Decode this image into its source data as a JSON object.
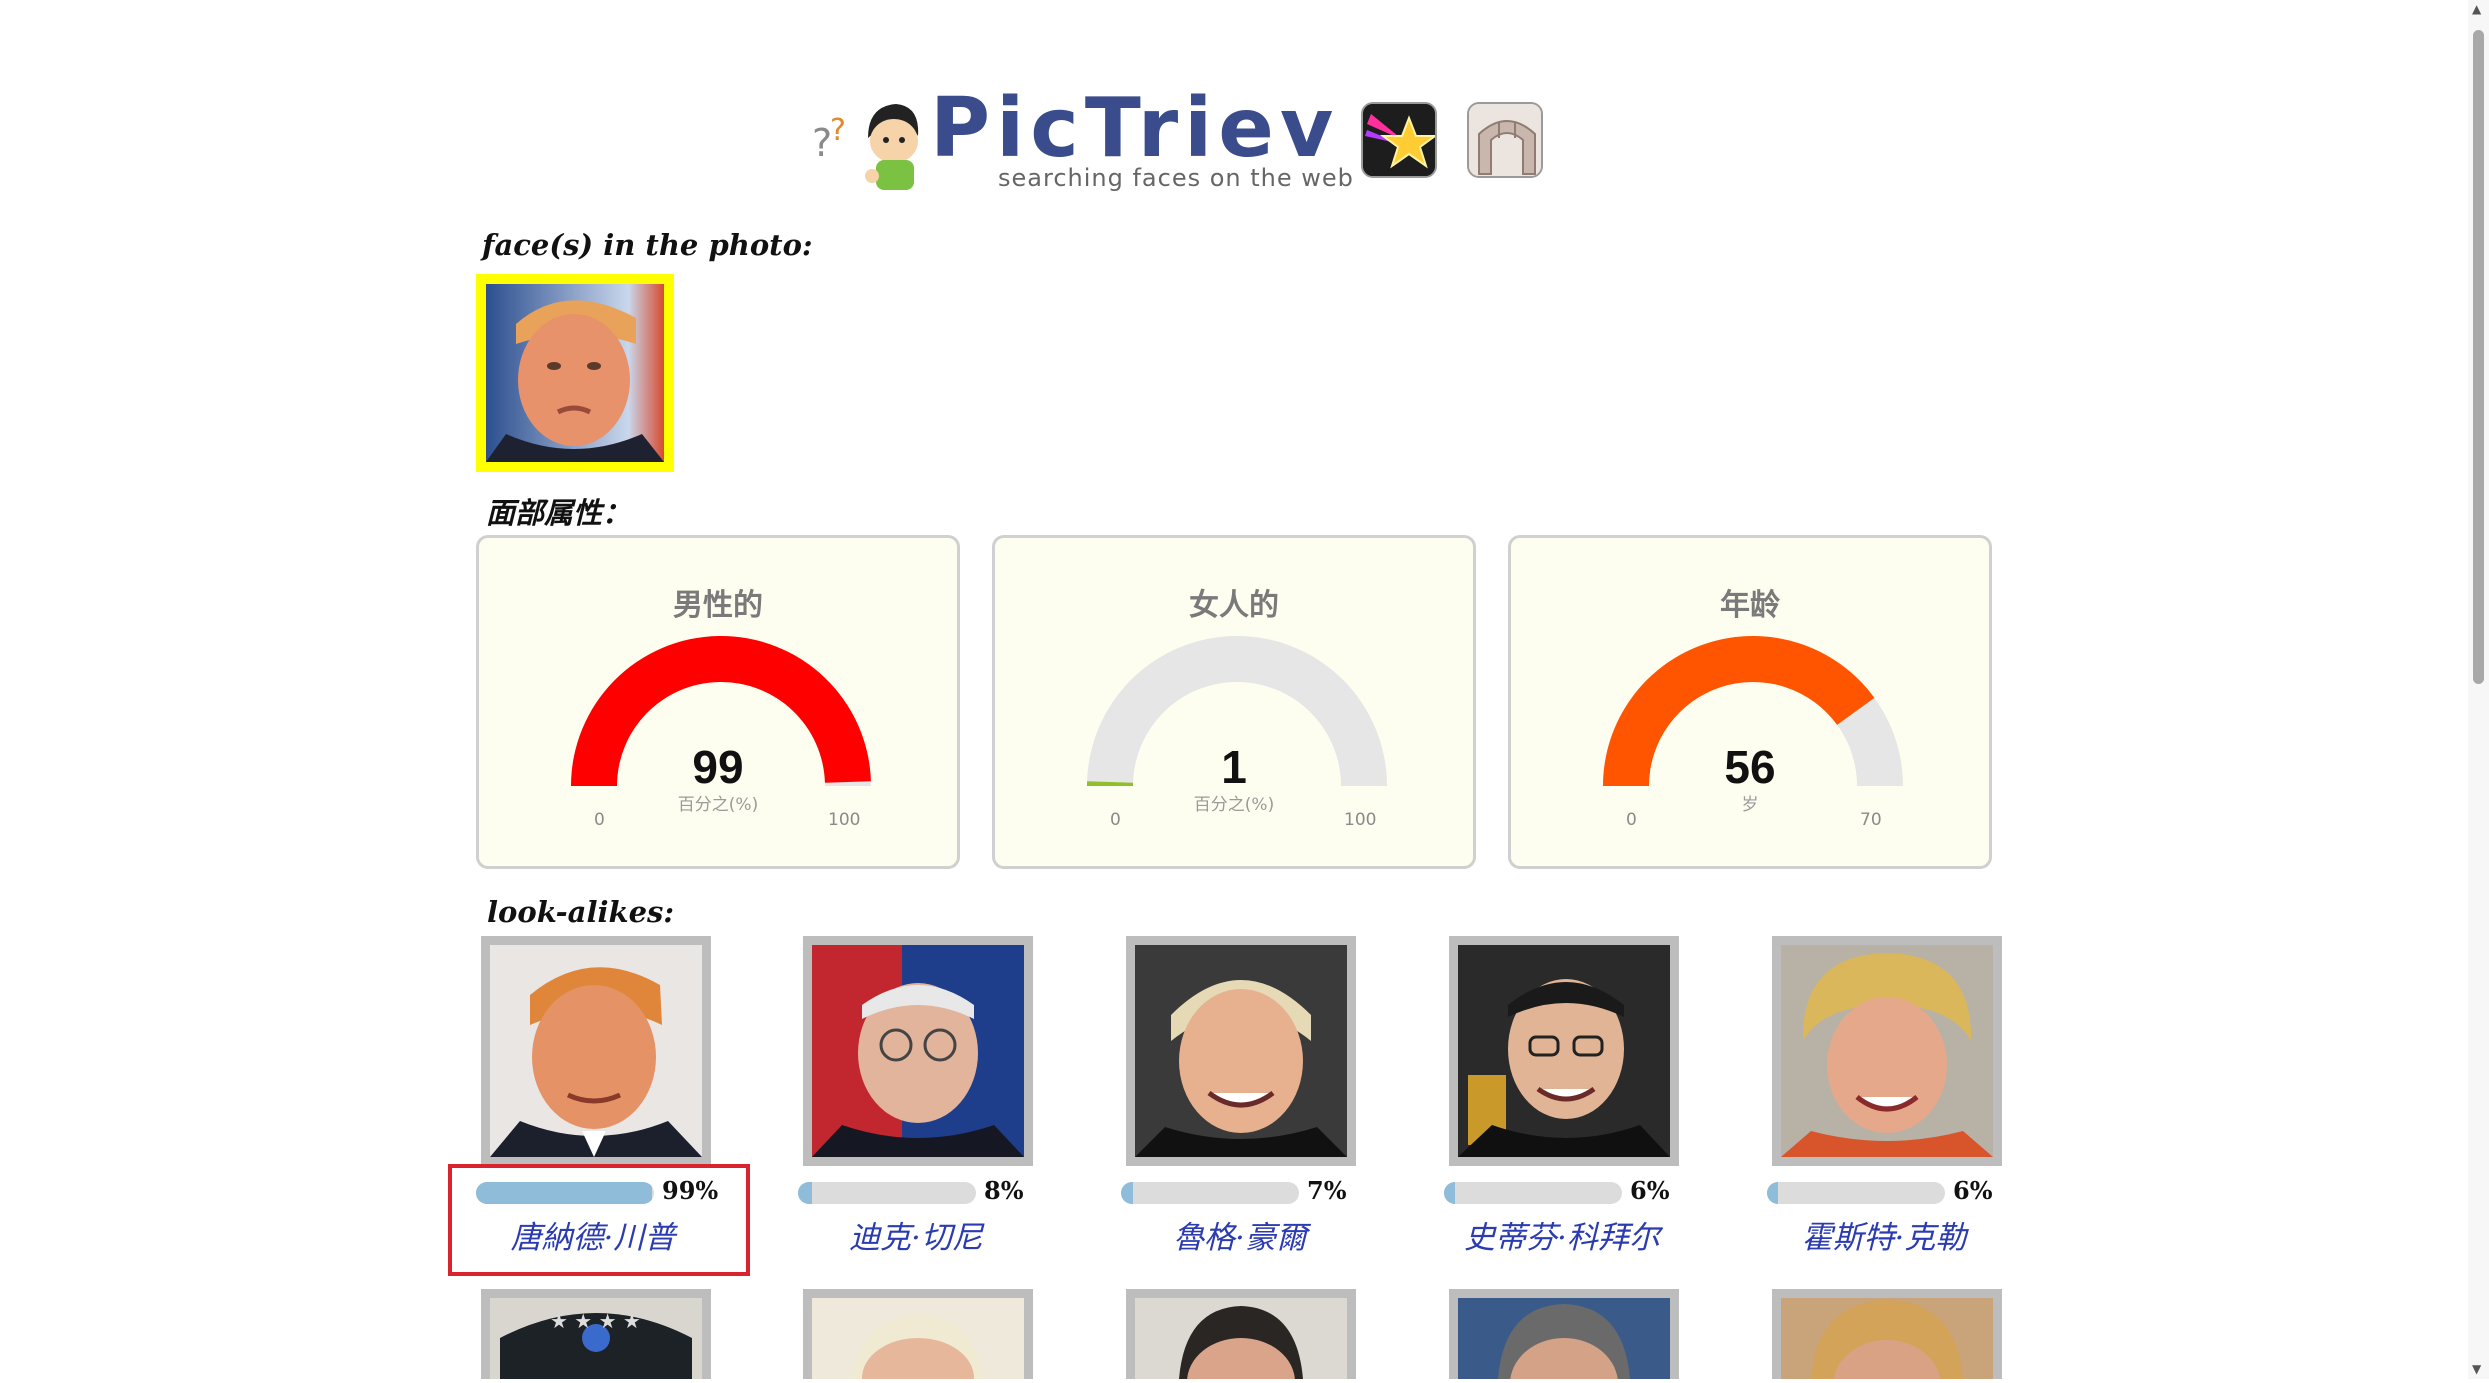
{
  "header": {
    "logo_title": "PicTriev",
    "logo_subtitle": "searching faces on the web",
    "buttons": [
      {
        "name": "celebrity-star",
        "icon": "shooting-star-icon"
      },
      {
        "name": "face-compare",
        "icon": "arch-icon"
      }
    ]
  },
  "faces_section": {
    "label": "face(s) in the photo:"
  },
  "attributes": {
    "label": "面部属性：",
    "gauges": [
      {
        "title": "男性的",
        "value": "99",
        "unit": "百分之(%)",
        "min": "0",
        "max": "100",
        "level": 99,
        "range_max": 100,
        "color": "#ff0000"
      },
      {
        "title": "女人的",
        "value": "1",
        "unit": "百分之(%)",
        "min": "0",
        "max": "100",
        "level": 1,
        "range_max": 100,
        "color": "#8fbf2a"
      },
      {
        "title": "年龄",
        "value": "56",
        "unit": "岁",
        "min": "0",
        "max": "70",
        "level": 56,
        "range_max": 70,
        "color": "#ff5500"
      }
    ]
  },
  "lookalikes": {
    "label": "look-alikes:",
    "items": [
      {
        "name": "唐納德·川普",
        "pct": "99%",
        "score": 99
      },
      {
        "name": "迪克·切尼",
        "pct": "8%",
        "score": 8
      },
      {
        "name": "魯格·豪爾",
        "pct": "7%",
        "score": 7
      },
      {
        "name": "史蒂芬·科拜尔",
        "pct": "6%",
        "score": 6
      },
      {
        "name": "霍斯特·克勒",
        "pct": "6%",
        "score": 6
      }
    ]
  },
  "colors": {
    "accent_name": "#2b3bb0",
    "highlight": "#d9232d",
    "face_frame": "#ffff00",
    "bar_fill": "#8fbcd8"
  }
}
